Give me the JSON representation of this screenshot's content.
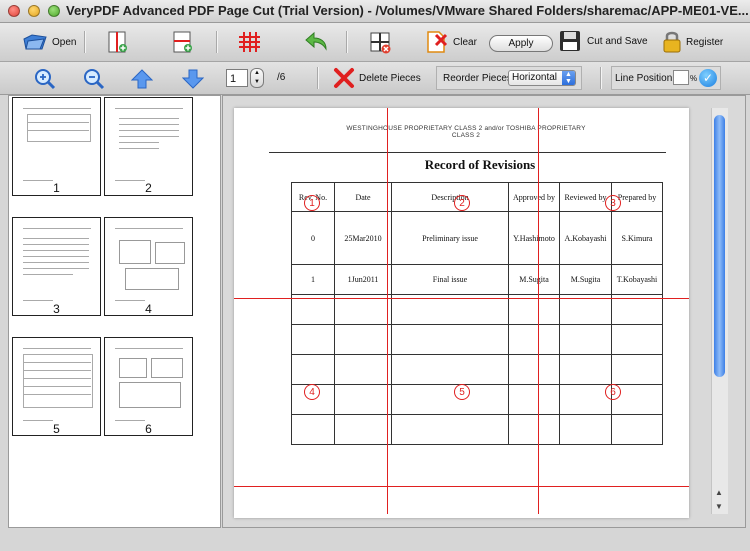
{
  "window": {
    "title": "VeryPDF Advanced PDF Page Cut (Trial Version) - /Volumes/VMware Shared Folders/sharemac/APP-ME01-VE..."
  },
  "toolbar": {
    "open_label": "Open",
    "clear_label": "Clear",
    "apply_label": "Apply",
    "cut_and_save_label": "Cut and Save",
    "register_label": "Register"
  },
  "nav": {
    "page_value": "1",
    "page_total": "/6",
    "delete_pieces_label": "Delete Pieces",
    "reorder_label": "Reorder Pieces:",
    "reorder_selected": "Horizontal",
    "line_position_label": "Line Position :",
    "percent_label": "%"
  },
  "thumbnails": [
    {
      "num": "1"
    },
    {
      "num": "2"
    },
    {
      "num": "3"
    },
    {
      "num": "4"
    },
    {
      "num": "5"
    },
    {
      "num": "6"
    }
  ],
  "document": {
    "header": "WESTINGHOUSE PROPRIETARY CLASS 2 and/or TOSHIBA PROPRIETARY CLASS 2",
    "title": "Record of Revisions",
    "columns": [
      "Rev. No.",
      "Date",
      "Description",
      "Approved by",
      "Reviewed by",
      "Prepared by"
    ],
    "rows": [
      [
        "0",
        "25Mar2010",
        "Preliminary issue",
        "Y.Hashimoto",
        "A.Kobayashi",
        "S.Kimura"
      ],
      [
        "1",
        "1Jun2011",
        "Final issue",
        "M.Sugita",
        "M.Sugita",
        "T.Kobayashi"
      ]
    ]
  },
  "markers": [
    "1",
    "2",
    "3",
    "4",
    "5",
    "6"
  ],
  "colors": {
    "cut_line": "#e02020",
    "accent_blue": "#2d6fdc"
  }
}
